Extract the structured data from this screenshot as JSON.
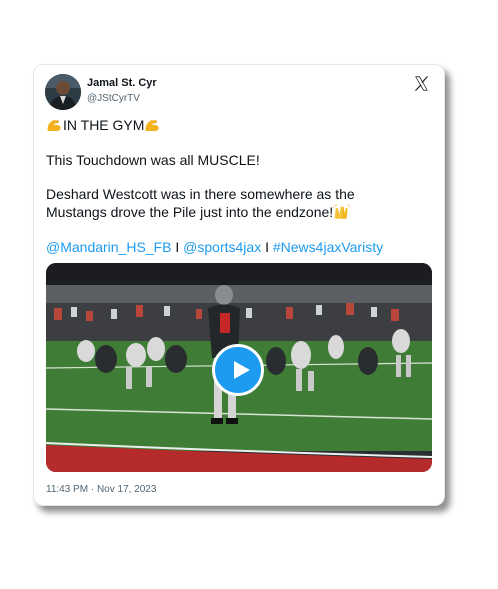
{
  "author": {
    "display_name": "Jamal St. Cyr",
    "handle": "@JStCyrTV",
    "avatar_icon": "person-avatar"
  },
  "brand_icon": "x-logo-icon",
  "tweet": {
    "line1": "IN THE GYM",
    "line1_emoji": "flexed-biceps-icon",
    "line2": "This Touchdown was all MUSCLE!",
    "line3": "Deshard Westcott was in there somewhere as the",
    "line4": "Mustangs drove the Pile just into the endzone!",
    "line4_emoji": "raising-hands-icon",
    "links": [
      "@Mandarin_HS_FB",
      "@sports4jax",
      "#News4jaxVaristy"
    ],
    "separator": "I"
  },
  "media": {
    "type": "video",
    "play_icon": "play-icon",
    "accent_color": "#1d9bf0"
  },
  "timestamp": "11:43 PM · Nov 17, 2023",
  "colors": {
    "text": "#0f1419",
    "secondary": "#536471",
    "link": "#1d9bf0",
    "field_green": "#3d7a33",
    "endzone_red": "#b52a2a"
  }
}
